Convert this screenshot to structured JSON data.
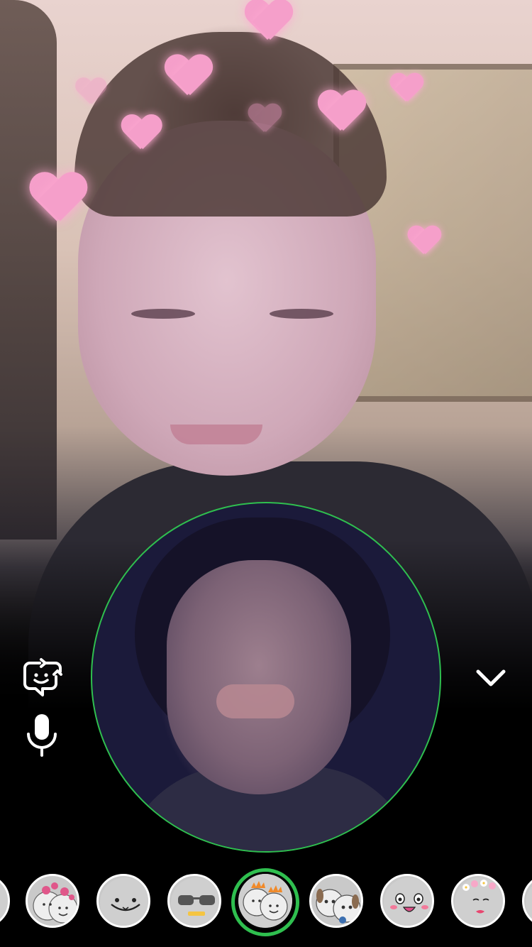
{
  "app": {
    "screen": "video-chat-with-lenses"
  },
  "colors": {
    "accent_green": "#2fbf4f",
    "icon_white": "#ffffff",
    "heart_pink": "#f59fca"
  },
  "controls": {
    "flip_camera_icon": "flip-camera-icon",
    "mic_icon": "microphone-icon",
    "collapse_icon": "chevron-down-icon"
  },
  "lenses": [
    {
      "icon": "partial-lens-icon",
      "selected": false
    },
    {
      "icon": "heart-couple-lens-icon",
      "selected": false
    },
    {
      "icon": "smiley-lens-icon",
      "selected": false
    },
    {
      "icon": "sunglasses-grill-lens-icon",
      "selected": false
    },
    {
      "icon": "fire-crown-couple-lens-icon",
      "selected": true
    },
    {
      "icon": "puppy-couple-lens-icon",
      "selected": false
    },
    {
      "icon": "blush-face-lens-icon",
      "selected": false
    },
    {
      "icon": "flower-crown-lens-icon",
      "selected": false
    },
    {
      "icon": "partial-lens-icon",
      "selected": false
    }
  ]
}
